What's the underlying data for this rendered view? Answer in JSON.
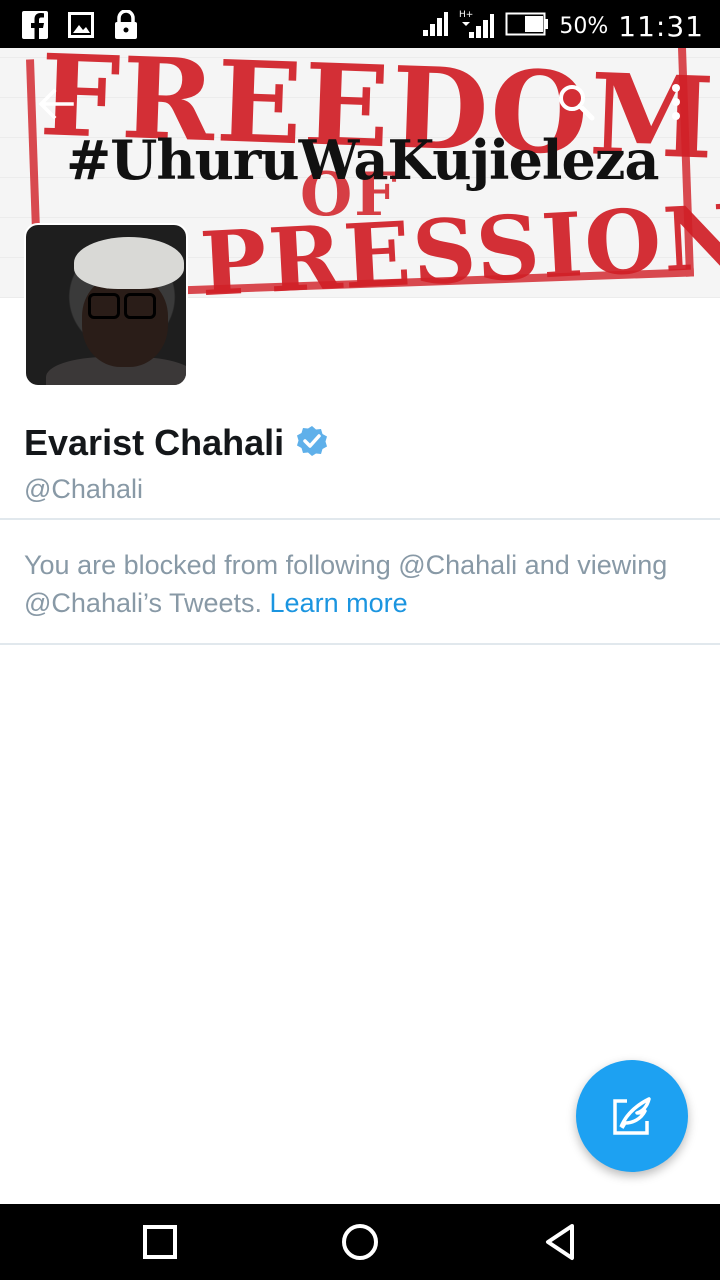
{
  "status_bar": {
    "battery_percent": "50%",
    "time": "11:31",
    "network": "H+",
    "icons": [
      "facebook-icon",
      "image-icon",
      "lock-icon",
      "signal-icon",
      "signal-hplus-icon",
      "battery-icon"
    ]
  },
  "header": {
    "banner_words": [
      "FREEDOM",
      "OF",
      "PRESSION"
    ],
    "banner_hashtag": "#UhuruWaKujieleza",
    "icons": [
      "back-arrow-icon",
      "search-icon",
      "more-vert-icon"
    ]
  },
  "profile": {
    "name": "Evarist Chahali",
    "handle": "@Chahali",
    "verified_icon": "verified-badge-icon"
  },
  "blocked": {
    "message": "You are blocked from following @Chahali and viewing @Chahali’s Tweets. ",
    "link": "Learn more"
  },
  "fab": {
    "icon": "compose-tweet-icon"
  },
  "nav_bar": {
    "icons": [
      "recent-apps-icon",
      "home-icon",
      "back-icon"
    ]
  },
  "colors": {
    "accent": "#1da1f2",
    "link": "#1b95e0",
    "muted_text": "#8899a6",
    "banner_red": "#d11f26"
  }
}
